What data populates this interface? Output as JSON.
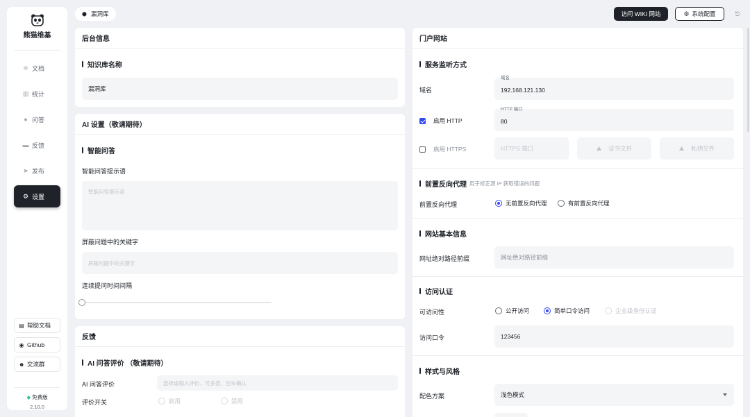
{
  "sidebar": {
    "brand": "熊猫维基",
    "items": [
      {
        "label": "文档",
        "icon": "layers-icon"
      },
      {
        "label": "统计",
        "icon": "bar-chart-icon"
      },
      {
        "label": "问答",
        "icon": "chat-bubble-icon"
      },
      {
        "label": "反馈",
        "icon": "message-box-icon"
      },
      {
        "label": "发布",
        "icon": "send-icon"
      },
      {
        "label": "设置",
        "icon": "gear-icon",
        "active": true
      }
    ],
    "bottom": [
      {
        "label": "帮助文档",
        "icon": "document-icon"
      },
      {
        "label": "Github",
        "icon": "github-icon"
      },
      {
        "label": "交流群",
        "icon": "group-icon"
      }
    ],
    "edition": "免费版",
    "version": "2.10.0"
  },
  "topbar": {
    "breadcrumb": "漏洞库",
    "visit_wiki": "访问 WIKI 网站",
    "system_config": "系统配置"
  },
  "backend": {
    "title": "后台信息",
    "kb_name_heading": "知识库名称",
    "kb_name_value": "漏洞库"
  },
  "ai": {
    "title": "AI 设置（敬请期待）",
    "smart_qa_heading": "智能问答",
    "prompt_label": "智能问答提示语",
    "prompt_placeholder": "智能问答提示语",
    "block_label": "屏蔽问题中的关键字",
    "block_placeholder": "屏蔽问题中的关键字",
    "interval_label": "连续提问时间间隔",
    "interval_value": 0
  },
  "feedback": {
    "title": "反馈",
    "eval_heading": "AI 问答评价 （敬请期待）",
    "eval_label": "AI 问答评价",
    "eval_placeholder": "选择或输入评价，可多选，回车确认",
    "switch_label": "评价开关",
    "enable": "启用",
    "disable": "禁用"
  },
  "portal": {
    "title": "门户网站",
    "listen_heading": "服务监听方式",
    "domain_label": "域名",
    "domain_mini": "域名",
    "domain_value": "192.168.121.130",
    "http_label": "启用 HTTP",
    "http_checked": true,
    "http_port_mini": "HTTP 端口",
    "http_port_value": "80",
    "https_label": "启用 HTTPS",
    "https_checked": false,
    "https_port_placeholder": "HTTPS 端口",
    "cert_file": "证书文件",
    "key_file": "私钥文件",
    "proxy_heading": "前置反向代理",
    "proxy_hint": "用于修正源 IP 获取错误的问题",
    "proxy_label": "前置反向代理",
    "proxy_none": "无前置反向代理",
    "proxy_has": "有前置反向代理",
    "basic_heading": "网站基本信息",
    "prefix_label": "网址绝对路径前缀",
    "prefix_placeholder": "网址绝对路径前缀",
    "auth_heading": "访问认证",
    "access_label": "可访问性",
    "access_public": "公开访问",
    "access_password": "简单口令访问",
    "access_sso": "企业级身份认证",
    "password_label": "访问口令",
    "password_value": "123456",
    "style_heading": "样式与风格",
    "color_label": "配色方案",
    "color_value": "浅色模式"
  },
  "colors": {
    "accent": "#3248f2",
    "dark": "#1f2329",
    "background": "#f0f1f4"
  }
}
